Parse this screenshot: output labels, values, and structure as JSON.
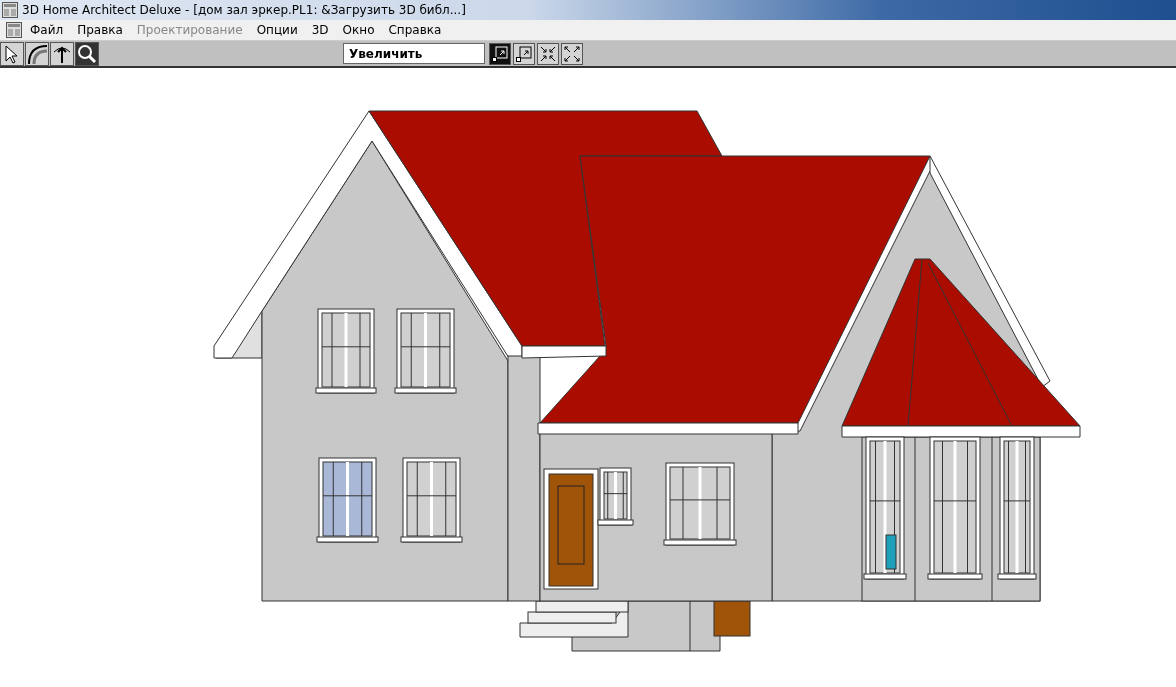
{
  "window": {
    "title": "3D Home Architect Deluxe - [дом зал эркер.PL1: &Загрузить 3D библ...]"
  },
  "menu": [
    {
      "label": "Файл",
      "disabled": false
    },
    {
      "label": "Правка",
      "disabled": false
    },
    {
      "label": "Проектирование",
      "disabled": true
    },
    {
      "label": "Опции",
      "disabled": false
    },
    {
      "label": "3D",
      "disabled": false
    },
    {
      "label": "Окно",
      "disabled": false
    },
    {
      "label": "Справка",
      "disabled": false
    }
  ],
  "tools": [
    {
      "kind": "pointer",
      "selected": false
    },
    {
      "kind": "arc",
      "selected": false
    },
    {
      "kind": "raise",
      "selected": false
    },
    {
      "kind": "zoom",
      "selected": true
    }
  ],
  "mode_field": {
    "value": "Увеличить"
  },
  "zoom_buttons": [
    {
      "kind": "zoom-in",
      "selected": true
    },
    {
      "kind": "zoom-out",
      "selected": false
    },
    {
      "kind": "fit",
      "selected": false
    },
    {
      "kind": "fill",
      "selected": false
    }
  ]
}
